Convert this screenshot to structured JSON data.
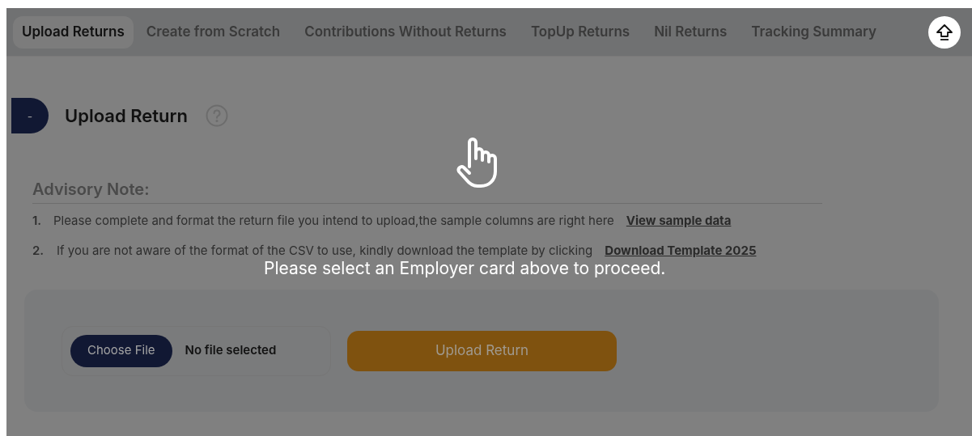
{
  "tabs": [
    {
      "label": "Upload Returns",
      "selected": true
    },
    {
      "label": "Create from Scratch",
      "selected": false
    },
    {
      "label": "Contributions Without Returns",
      "selected": false
    },
    {
      "label": "TopUp Returns",
      "selected": false
    },
    {
      "label": "Nil Returns",
      "selected": false
    },
    {
      "label": "Tracking Summary",
      "selected": false
    }
  ],
  "section": {
    "toggle": "-",
    "title": "Upload Return"
  },
  "advisory": {
    "heading": "Advisory Note:",
    "items": [
      {
        "number": "1.",
        "text": "Please complete and format the return file you intend to upload,the sample columns are right here",
        "link": "View sample data"
      },
      {
        "number": "2.",
        "text": "If you are not aware of the format of the CSV to use, kindly download the template by clicking",
        "link": "Download Template 2025"
      }
    ]
  },
  "upload": {
    "choose_button": "Choose File",
    "file_status": "No file selected",
    "submit_button": "Upload Return",
    "disabled": true
  },
  "overlay": {
    "message": "Please select an Employer card above to proceed."
  }
}
